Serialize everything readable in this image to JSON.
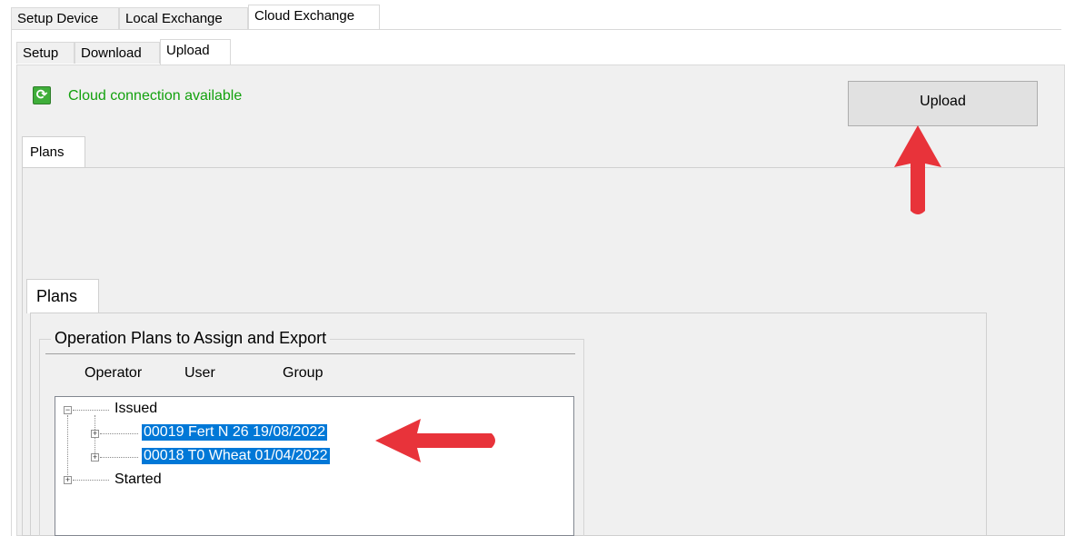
{
  "top_tabs": [
    "Setup Device",
    "Local Exchange",
    "Cloud Exchange"
  ],
  "sub_tabs": [
    "Setup",
    "Download",
    "Upload"
  ],
  "status": {
    "text": "Cloud connection available",
    "icon": "refresh-icon"
  },
  "upload_button": {
    "label": "Upload"
  },
  "plans_tab_outer": "Plans",
  "plans_tab_inner": "Plans",
  "groupbox": {
    "title": "Operation Plans to Assign and Export",
    "columns": [
      "Operator",
      "User",
      "Group"
    ]
  },
  "tree": {
    "issued": "Issued",
    "items": [
      "00019 Fert N 26 19/08/2022",
      "00018 T0 Wheat 01/04/2022"
    ],
    "started": "Started"
  },
  "colors": {
    "accent": "#e8333a",
    "selection": "#0078d7",
    "status_green": "#13a10e"
  }
}
